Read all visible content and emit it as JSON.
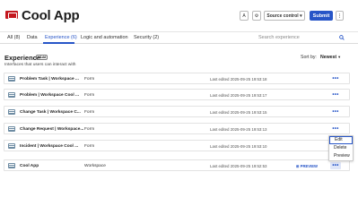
{
  "app": {
    "title": "Cool App"
  },
  "toolbar": {
    "ai_label": "A",
    "gear_label": "⚙",
    "source_label": "Source control ▾",
    "submit_label": "Submit",
    "kebab_label": "⋮"
  },
  "tabs": [
    {
      "label": "All (8)",
      "active": false
    },
    {
      "label": "Data",
      "active": false
    },
    {
      "label": "Experience (6)",
      "active": true
    },
    {
      "label": "Logic and automation",
      "active": false
    },
    {
      "label": "Security (2)",
      "active": false
    }
  ],
  "search": {
    "placeholder": "Search experience"
  },
  "section": {
    "title": "Experience",
    "add_label": "+Add",
    "subtitle": "Interfaces that users can interact with",
    "sort_label": "Sort by:",
    "sort_value": "Newest",
    "sort_caret": "▾"
  },
  "rows": [
    {
      "name": "Problem Task | Workspace ...",
      "type": "Form",
      "edited": "Last edited 2025-09-25 19:53:18",
      "preview": "",
      "kebab": "•••"
    },
    {
      "name": "Problem | Workspace Cool ...",
      "type": "Form",
      "edited": "Last edited 2025-09-25 19:53:17",
      "preview": "",
      "kebab": "•••"
    },
    {
      "name": "Change Task | Workspace C...",
      "type": "Form",
      "edited": "Last edited 2025-09-25 19:53:15",
      "preview": "",
      "kebab": "•••"
    },
    {
      "name": "Change Request | Workspace...",
      "type": "Form",
      "edited": "Last edited 2025-09-25 19:53:13",
      "preview": "",
      "kebab": "•••"
    },
    {
      "name": "Incident | Workspace Cool ...",
      "type": "Form",
      "edited": "Last edited 2025-09-25 19:53:10",
      "preview": "",
      "kebab": "•••"
    },
    {
      "name": "Cool App",
      "type": "Workspace",
      "edited": "Last edited 2025-09-25 19:52:53",
      "preview": "⊞ PREVIEW",
      "kebab": "•••"
    }
  ],
  "context_menu": {
    "items": [
      "Edit",
      "Delete",
      "Preview"
    ]
  },
  "colors": {
    "accent": "#2755c7",
    "brand": "#c4181f"
  }
}
